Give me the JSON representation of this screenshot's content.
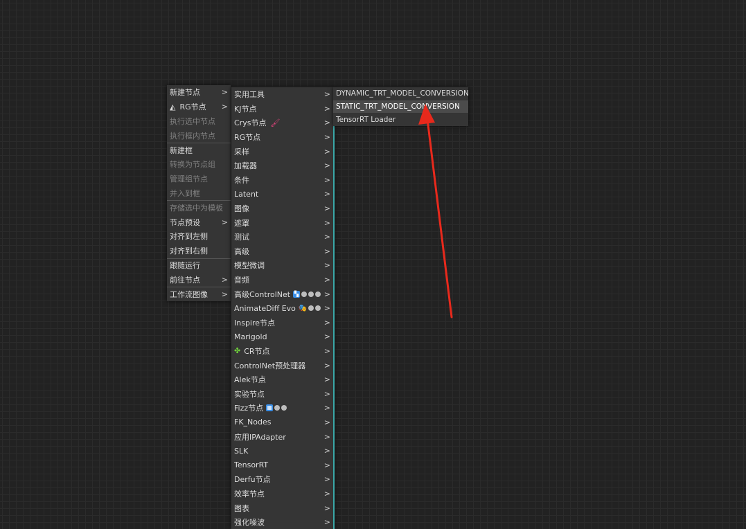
{
  "main_menu": {
    "items": [
      {
        "label": "新建节点",
        "submenu": true,
        "disabled": false
      },
      {
        "label": "RG节点",
        "submenu": true,
        "disabled": false,
        "icon": "rg-logo-icon"
      },
      {
        "label": "执行选中节点",
        "submenu": false,
        "disabled": true
      },
      {
        "label": "执行框内节点",
        "submenu": false,
        "disabled": true
      },
      {
        "label": "新建框",
        "submenu": false,
        "disabled": false
      },
      {
        "label": "转换为节点组",
        "submenu": false,
        "disabled": true
      },
      {
        "label": "管理组节点",
        "submenu": false,
        "disabled": true
      },
      {
        "label": "并入到框",
        "submenu": false,
        "disabled": true
      },
      {
        "label": "存储选中为模板",
        "submenu": false,
        "disabled": true
      },
      {
        "label": "节点预设",
        "submenu": true,
        "disabled": false
      },
      {
        "label": "对齐到左侧",
        "submenu": false,
        "disabled": false
      },
      {
        "label": "对齐到右侧",
        "submenu": false,
        "disabled": false
      },
      {
        "label": "跟随运行",
        "submenu": false,
        "disabled": false
      },
      {
        "label": "前往节点",
        "submenu": true,
        "disabled": false
      },
      {
        "label": "工作流图像",
        "submenu": true,
        "disabled": false
      }
    ]
  },
  "sub_menu": {
    "items": [
      {
        "label": "实用工具"
      },
      {
        "label": "KJ节点"
      },
      {
        "label": "Crys节点"
      },
      {
        "label": "RG节点"
      },
      {
        "label": "采样"
      },
      {
        "label": "加载器"
      },
      {
        "label": "条件"
      },
      {
        "label": "Latent"
      },
      {
        "label": "图像"
      },
      {
        "label": "遮罩"
      },
      {
        "label": "测试"
      },
      {
        "label": "高级"
      },
      {
        "label": "模型微调"
      },
      {
        "label": "音频"
      },
      {
        "label": "高级ControlNet"
      },
      {
        "label": "AnimateDiff Evo"
      },
      {
        "label": "Inspire节点"
      },
      {
        "label": "Marigold"
      },
      {
        "label": "CR节点"
      },
      {
        "label": "ControlNet预处理器"
      },
      {
        "label": "Alek节点"
      },
      {
        "label": "实验节点"
      },
      {
        "label": "Fizz节点"
      },
      {
        "label": "FK_Nodes"
      },
      {
        "label": "应用IPAdapter"
      },
      {
        "label": "SLK"
      },
      {
        "label": "TensorRT"
      },
      {
        "label": "Derfu节点"
      },
      {
        "label": "效率节点"
      },
      {
        "label": "图表"
      },
      {
        "label": "强化噪波"
      }
    ]
  },
  "tensorrt_menu": {
    "items": [
      {
        "label": "DYNAMIC_TRT_MODEL_CONVERSION",
        "hovered": false
      },
      {
        "label": "STATIC_TRT_MODEL_CONVERSION",
        "hovered": true
      },
      {
        "label": "TensorRT Loader",
        "hovered": false
      }
    ]
  },
  "arrow_glyph": ">",
  "colors": {
    "canvas_bg": "#222222",
    "menu_bg": "#353535",
    "submenu_border": "#3aa8a8",
    "hover_bg": "#4b4b4b",
    "annotation_arrow": "#e8291c"
  }
}
